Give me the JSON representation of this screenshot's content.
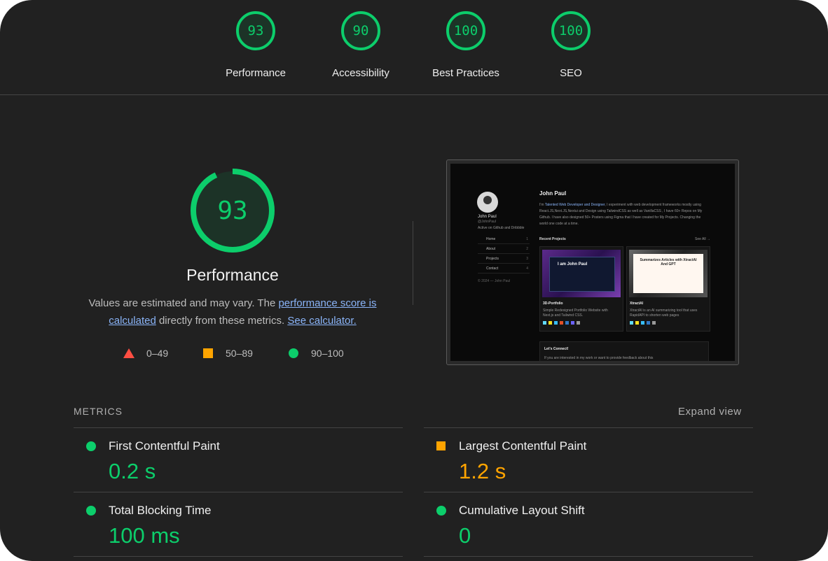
{
  "categories": [
    {
      "score": "93",
      "label": "Performance"
    },
    {
      "score": "90",
      "label": "Accessibility"
    },
    {
      "score": "100",
      "label": "Best Practices"
    },
    {
      "score": "100",
      "label": "SEO"
    }
  ],
  "summary": {
    "score": "93",
    "score_fraction": 0.93,
    "title": "Performance",
    "desc_prefix": "Values are estimated and may vary. The ",
    "desc_link1": "performance score is calculated",
    "desc_mid": " directly from these metrics. ",
    "desc_link2": "See calculator.",
    "legend": [
      "0–49",
      "50–89",
      "90–100"
    ]
  },
  "colors": {
    "pass": "#0cce6b",
    "average": "#ffa400",
    "fail": "#ff4e42",
    "background": "#212121"
  },
  "thumbnail": {
    "name": "John Paul",
    "handle": "@JohnPaul",
    "status": "Active on Github and Dribbble",
    "nav": [
      "Home",
      "About",
      "Projects",
      "Contact"
    ],
    "nav_keys": [
      "1",
      "2",
      "3",
      "4"
    ],
    "footer": "© 2024 — John Paul",
    "heading": "John Paul",
    "para_start": "I'm ",
    "para_highlight": "Talented Web Developer and Designer",
    "para_rest": ", I experiment with web development frameworks mostly using React.JS,Next.JS,Nextui and Design using TailwindCSS as well as VanillaCSS , I have 60+ Repos on My Github. I have also designed 50+ Posters using Figma that I have created for My Projects. Changing the world one code at a time.",
    "recent": "Recent Projects",
    "see_all": "See All →",
    "cards": [
      {
        "img_text": "I am John Paul",
        "title": "3D-Portfolio",
        "desc": "Simple Redesigned Portfolio Website with Next.js and Tailwind CSS."
      },
      {
        "img_text": "Summarizes Articles with XtractAI And GPT",
        "title": "XtractAI",
        "desc": "XtractAI is an AI summarizing tool that uses RapidAPI to shorten web pages"
      }
    ],
    "connect": "Let's Connect!",
    "connect_text": "If you are interested in my work or want to provide feedback about this"
  },
  "metrics": {
    "header": "METRICS",
    "expand": "Expand view",
    "items": [
      {
        "title": "First Contentful Paint",
        "value": "0.2 s",
        "rating": "pass"
      },
      {
        "title": "Largest Contentful Paint",
        "value": "1.2 s",
        "rating": "average"
      },
      {
        "title": "Total Blocking Time",
        "value": "100 ms",
        "rating": "pass"
      },
      {
        "title": "Cumulative Layout Shift",
        "value": "0",
        "rating": "pass"
      }
    ]
  }
}
